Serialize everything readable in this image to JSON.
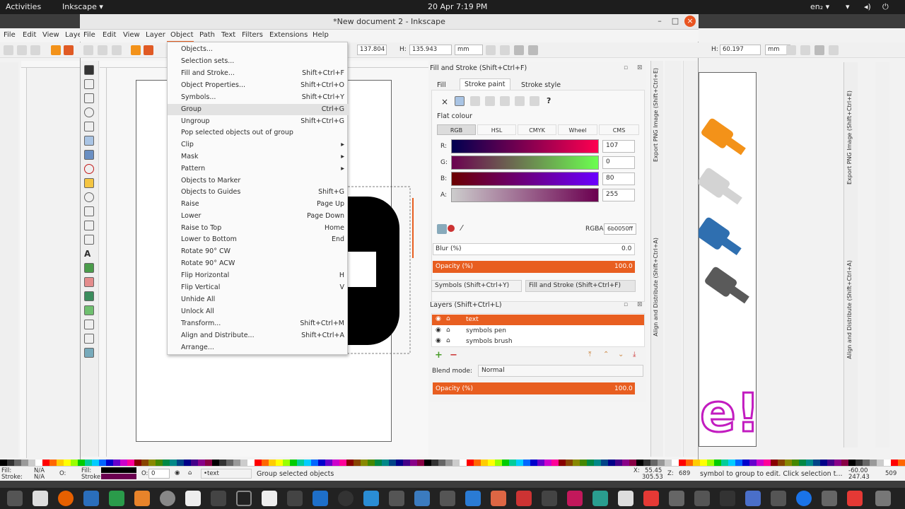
{
  "topbar": {
    "activities": "Activities",
    "app": "Inkscape ▾",
    "datetime": "20 Apr  7:19 PM",
    "lang": "en₂ ▾"
  },
  "window": {
    "title": "*New document 2 - Inkscape"
  },
  "menubar": {
    "left_items": [
      "File",
      "Edit",
      "View",
      "Laye"
    ],
    "items": [
      "File",
      "Edit",
      "View",
      "Layer",
      "Object",
      "Path",
      "Text",
      "Filters",
      "Extensions",
      "Help"
    ]
  },
  "toolbar": {
    "w_value": "137.804",
    "h_label": "H:",
    "h_value": "135.943",
    "unit": "mm",
    "right_h_label": "H:",
    "right_h_value": "60.197",
    "right_unit": "mm"
  },
  "object_menu": {
    "items": [
      {
        "label": "Objects...",
        "shortcut": ""
      },
      {
        "label": "Selection sets...",
        "shortcut": ""
      },
      {
        "label": "Fill and Stroke...",
        "shortcut": "Shift+Ctrl+F"
      },
      {
        "label": "Object Properties...",
        "shortcut": "Shift+Ctrl+O"
      },
      {
        "label": "Symbols...",
        "shortcut": "Shift+Ctrl+Y"
      },
      {
        "label": "Group",
        "shortcut": "Ctrl+G"
      },
      {
        "label": "Ungroup",
        "shortcut": "Shift+Ctrl+G"
      },
      {
        "label": "Pop selected objects out of group",
        "shortcut": ""
      },
      {
        "label": "Clip",
        "shortcut": "▸"
      },
      {
        "label": "Mask",
        "shortcut": "▸"
      },
      {
        "label": "Pattern",
        "shortcut": "▸"
      },
      {
        "label": "Objects to Marker",
        "shortcut": ""
      },
      {
        "label": "Objects to Guides",
        "shortcut": "Shift+G"
      },
      {
        "label": "Raise",
        "shortcut": "Page Up"
      },
      {
        "label": "Lower",
        "shortcut": "Page Down"
      },
      {
        "label": "Raise to Top",
        "shortcut": "Home"
      },
      {
        "label": "Lower to Bottom",
        "shortcut": "End"
      },
      {
        "label": "Rotate 90° CW",
        "shortcut": ""
      },
      {
        "label": "Rotate 90° ACW",
        "shortcut": ""
      },
      {
        "label": "Flip Horizontal",
        "shortcut": "H"
      },
      {
        "label": "Flip Vertical",
        "shortcut": "V"
      },
      {
        "label": "Unhide All",
        "shortcut": ""
      },
      {
        "label": "Unlock All",
        "shortcut": ""
      },
      {
        "label": "Transform...",
        "shortcut": "Shift+Ctrl+M"
      },
      {
        "label": "Align and Distribute...",
        "shortcut": "Shift+Ctrl+A"
      },
      {
        "label": "Arrange...",
        "shortcut": ""
      }
    ],
    "highlighted_index": 5
  },
  "fill_stroke": {
    "title": "Fill and Stroke (Shift+Ctrl+F)",
    "tabs": [
      "Fill",
      "Stroke paint",
      "Stroke style"
    ],
    "x_label": "×",
    "help": "?",
    "flat_colour": "Flat colour",
    "color_modes": [
      "RGB",
      "HSL",
      "CMYK",
      "Wheel",
      "CMS"
    ],
    "channels": [
      {
        "label": "R:",
        "value": "107"
      },
      {
        "label": "G:",
        "value": "0"
      },
      {
        "label": "B:",
        "value": "80"
      },
      {
        "label": "A:",
        "value": "255"
      }
    ],
    "rgba_label": "RGBA:",
    "rgba_value": "6b0050ff",
    "blur_label": "Blur (%)",
    "blur_value": "0.0",
    "opacity_label": "Opacity (%)",
    "opacity_value": "100.0",
    "tab_symbols": "Symbols (Shift+Ctrl+Y)",
    "tab_fill": "Fill and Stroke (Shift+Ctrl+F)"
  },
  "layers": {
    "title": "Layers (Shift+Ctrl+L)",
    "items": [
      "text",
      "symbols pen",
      "symbols brush"
    ],
    "blend_label": "Blend mode:",
    "blend_value": "Normal",
    "opacity_label": "Opacity (%)",
    "opacity_value": "100.0"
  },
  "right_strip": {
    "labels": [
      "Export PNG Image (Shift+Ctrl+E)",
      "Align and Distribute (Shift+Ctrl+A)",
      "Fill and Stroke (Shift+Ctrl+F)"
    ]
  },
  "statusbar": {
    "fill_label": "Fill:",
    "fill_value": "N/A",
    "stroke_label": "Stroke:",
    "stroke_value": "N/A",
    "o_label": "O:",
    "o_value": "0",
    "layer": "•text",
    "message": "Group selected objects",
    "x_label": "X:",
    "x_value": "55.45",
    "y_value": "305.53",
    "z_label": "Z:",
    "zoom": "689",
    "right_message": "symbol to group to edit. Click selection t...",
    "right_x": "-60.00",
    "right_y": "247.43",
    "right_zoom": "509"
  },
  "colors": {
    "accent": "#e85e20",
    "shape": "#000000",
    "brush_orange": "#f39219",
    "brush_blue": "#2f6fb0",
    "magenta": "#c21cc0"
  }
}
